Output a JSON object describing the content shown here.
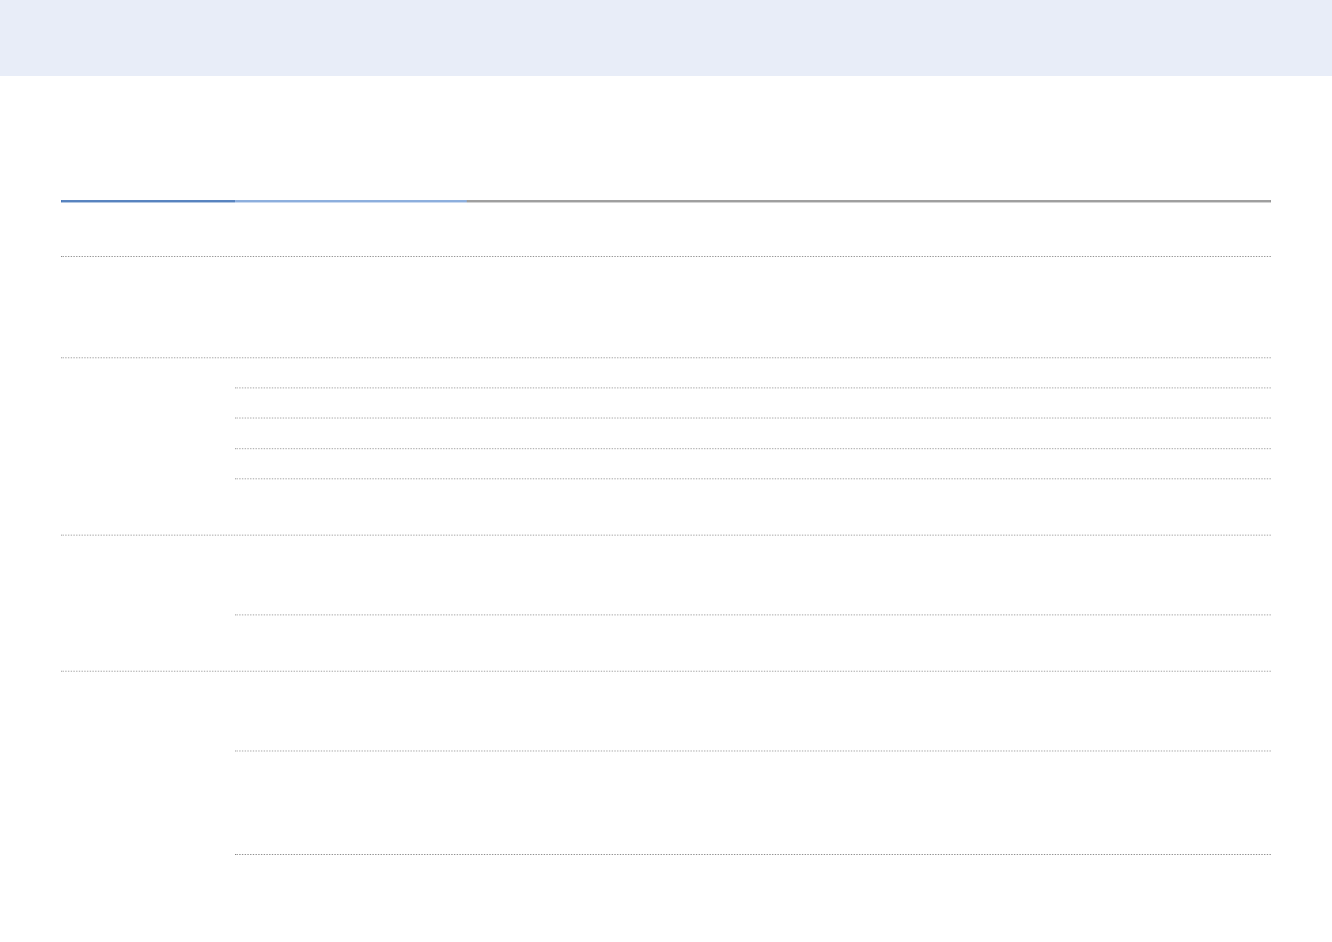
{
  "page": {
    "band_color": "#e8edf8",
    "rule_accent_1": "#5b86c1",
    "rule_accent_2": "#8fb0de",
    "rule_gray": "#a0a0a0",
    "dotted_rule_color": "#8a8a8a"
  }
}
